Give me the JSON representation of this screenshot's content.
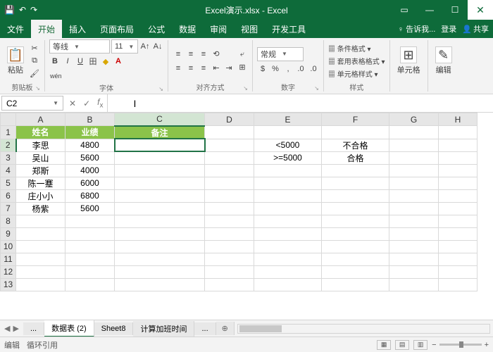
{
  "title": "Excel演示.xlsx - Excel",
  "menu": {
    "file": "文件",
    "home": "开始",
    "insert": "插入",
    "layout": "页面布局",
    "formulas": "公式",
    "data": "数据",
    "review": "审阅",
    "view": "视图",
    "dev": "开发工具",
    "tell": "告诉我...",
    "login": "登录",
    "share": "共享"
  },
  "ribbon": {
    "clipboard": "剪贴板",
    "paste": "粘贴",
    "font": "字体",
    "fontname": "等线",
    "fontsize": "11",
    "alignment": "对齐方式",
    "number": "数字",
    "numfmt": "常规",
    "styles": "样式",
    "condfmt": "条件格式",
    "tblfmt": "套用表格格式",
    "cellstyle": "单元格样式",
    "cells": "单元格",
    "editing": "编辑"
  },
  "namebox": "C2",
  "chart_data": {
    "type": "table",
    "headers": [
      "姓名",
      "业绩",
      "备注"
    ],
    "rows": [
      [
        "李思",
        4800,
        ""
      ],
      [
        "吴山",
        5600,
        ""
      ],
      [
        "郑斯",
        4000,
        ""
      ],
      [
        "陈一蹇",
        6000,
        ""
      ],
      [
        "庄小小",
        6800,
        ""
      ],
      [
        "杨紫",
        5600,
        ""
      ]
    ],
    "criteria": [
      [
        "<5000",
        "不合格"
      ],
      [
        ">=5000",
        "合格"
      ]
    ]
  },
  "cols": [
    "A",
    "B",
    "C",
    "D",
    "E",
    "F",
    "G",
    "H"
  ],
  "rows_shown": 13,
  "sheets": {
    "active": "数据表 (2)",
    "others": [
      "Sheet8",
      "计算加班时间"
    ],
    "more": "..."
  },
  "status": {
    "edit": "编辑",
    "circ": "循环引用",
    "zoom": ""
  }
}
